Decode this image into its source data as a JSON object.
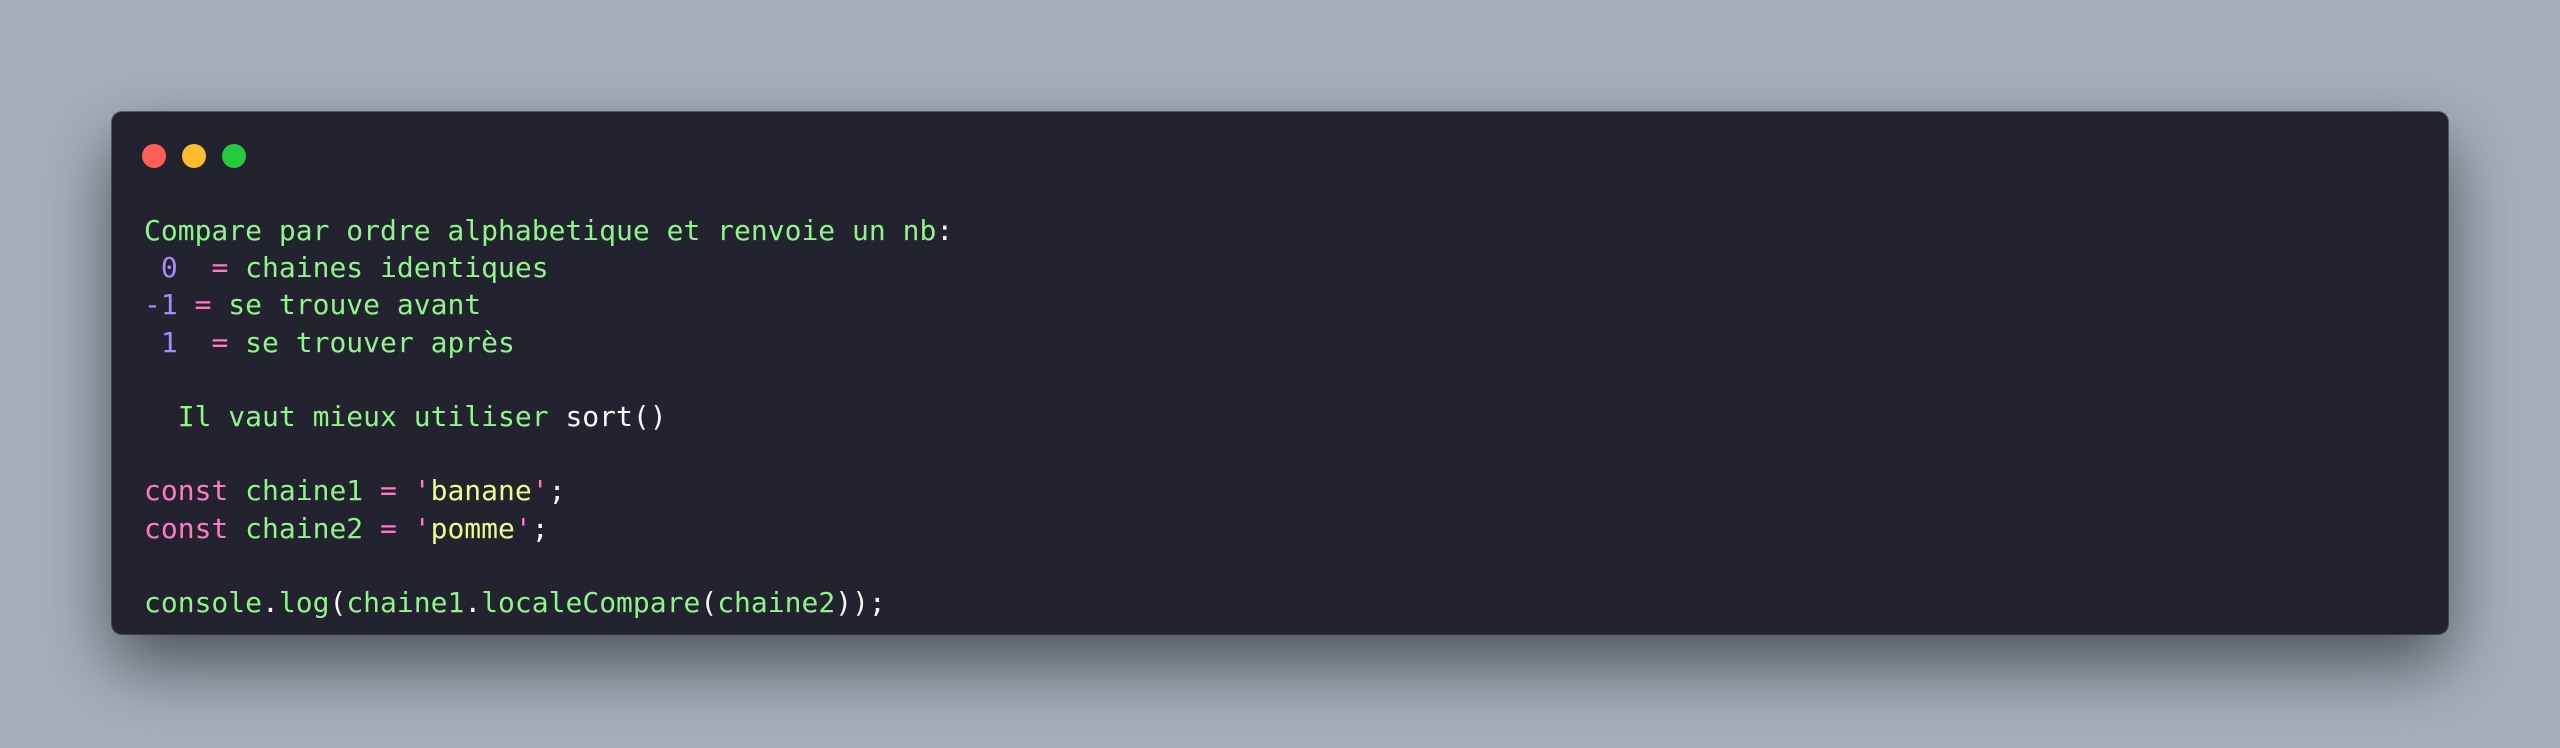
{
  "window": {
    "controls": [
      {
        "name": "close",
        "color": "#ff5f56"
      },
      {
        "name": "minimize",
        "color": "#ffbd2e"
      },
      {
        "name": "zoom",
        "color": "#27c93f"
      }
    ]
  },
  "colors": {
    "background": "#a5b0bb",
    "editor": "#23222f",
    "green": "#8ff58a",
    "pink": "#ff79c6",
    "purple": "#a78bfa",
    "yellow": "#f1fa8c",
    "white": "#f8f8f2"
  },
  "code": {
    "lines": [
      [
        {
          "text": "Compare par ordre alphabetique et renvoie un nb",
          "color": "green"
        },
        {
          "text": ":",
          "color": "white"
        }
      ],
      [
        {
          "text": " ",
          "color": "white"
        },
        {
          "text": "0",
          "color": "purple"
        },
        {
          "text": "  ",
          "color": "white"
        },
        {
          "text": "=",
          "color": "pink"
        },
        {
          "text": " chaines identiques",
          "color": "green"
        }
      ],
      [
        {
          "text": "-1",
          "color": "purple"
        },
        {
          "text": " ",
          "color": "white"
        },
        {
          "text": "=",
          "color": "pink"
        },
        {
          "text": " se trouve avant",
          "color": "green"
        }
      ],
      [
        {
          "text": " ",
          "color": "white"
        },
        {
          "text": "1",
          "color": "purple"
        },
        {
          "text": "  ",
          "color": "white"
        },
        {
          "text": "=",
          "color": "pink"
        },
        {
          "text": " se trouver après",
          "color": "green"
        }
      ],
      [],
      [
        {
          "text": "  Il vaut mieux utiliser ",
          "color": "green"
        },
        {
          "text": "sort()",
          "color": "white"
        }
      ],
      [],
      [
        {
          "text": "const",
          "color": "pink"
        },
        {
          "text": " chaine1 ",
          "color": "green"
        },
        {
          "text": "=",
          "color": "pink"
        },
        {
          "text": " ",
          "color": "white"
        },
        {
          "text": "'",
          "color": "pink"
        },
        {
          "text": "banane",
          "color": "yellow"
        },
        {
          "text": "'",
          "color": "pink"
        },
        {
          "text": ";",
          "color": "white"
        }
      ],
      [
        {
          "text": "const",
          "color": "pink"
        },
        {
          "text": " chaine2 ",
          "color": "green"
        },
        {
          "text": "=",
          "color": "pink"
        },
        {
          "text": " ",
          "color": "white"
        },
        {
          "text": "'",
          "color": "pink"
        },
        {
          "text": "pomme",
          "color": "yellow"
        },
        {
          "text": "'",
          "color": "pink"
        },
        {
          "text": ";",
          "color": "white"
        }
      ],
      [],
      [
        {
          "text": "console",
          "color": "green"
        },
        {
          "text": ".",
          "color": "white"
        },
        {
          "text": "log",
          "color": "green"
        },
        {
          "text": "(",
          "color": "white"
        },
        {
          "text": "chaine1",
          "color": "green"
        },
        {
          "text": ".",
          "color": "white"
        },
        {
          "text": "localeCompare",
          "color": "green"
        },
        {
          "text": "(",
          "color": "white"
        },
        {
          "text": "chaine2",
          "color": "green"
        },
        {
          "text": "));",
          "color": "white"
        }
      ]
    ]
  }
}
